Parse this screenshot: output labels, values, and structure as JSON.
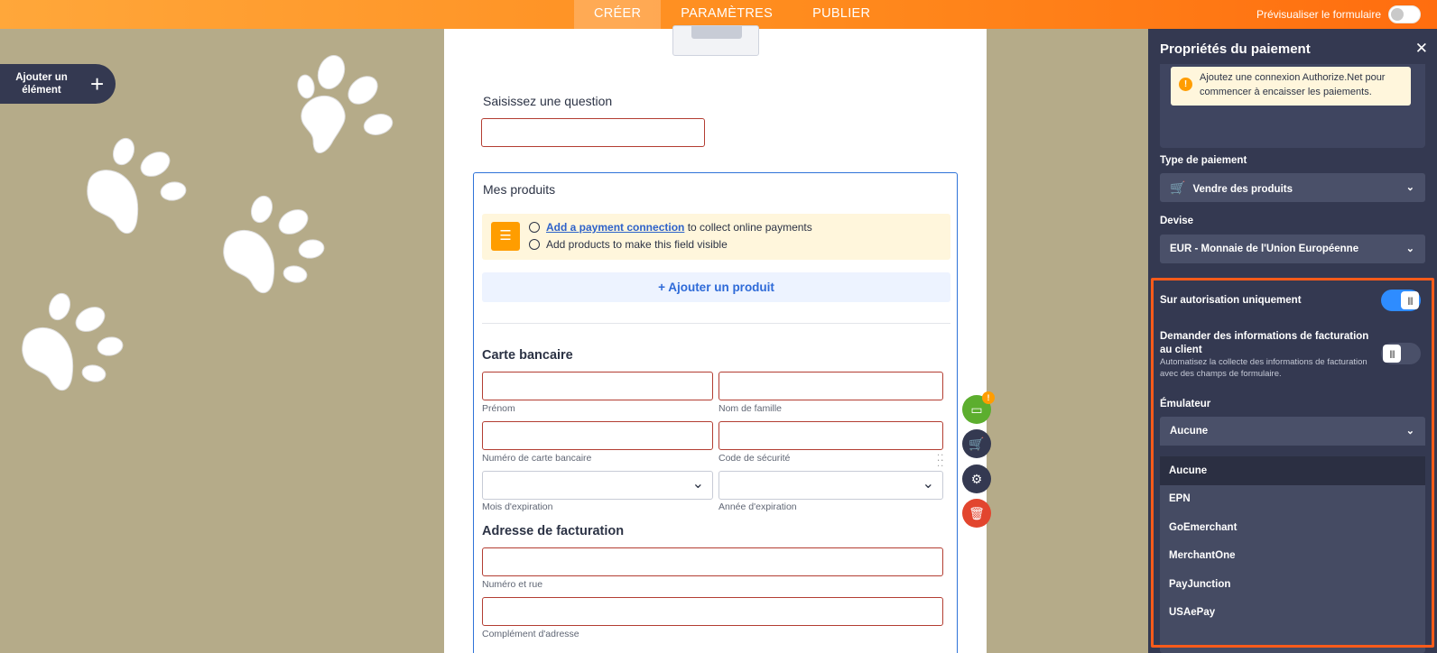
{
  "topbar": {
    "tabs": [
      "CRÉER",
      "PARAMÈTRES",
      "PUBLIER"
    ],
    "preview_label": "Prévisualiser le formulaire"
  },
  "add_element": {
    "label": "Ajouter un élément"
  },
  "form": {
    "question_label": "Saisissez une question",
    "products": {
      "title": "Mes produits",
      "notice_link": "Add a payment connection",
      "notice_line1_rest": " to collect online payments",
      "notice_line2": "Add products to make this field visible",
      "add_product_label": "+ Ajouter un produit"
    },
    "card": {
      "title": "Carte bancaire",
      "first_name": "Prénom",
      "last_name": "Nom de famille",
      "card_number": "Numéro de carte bancaire",
      "security_code": "Code de sécurité",
      "exp_month": "Mois d'expiration",
      "exp_year": "Année d'expiration"
    },
    "billing": {
      "title": "Adresse de facturation",
      "street": "Numéro et rue",
      "address2": "Complément d'adresse"
    }
  },
  "tools": {
    "badge": "!"
  },
  "panel": {
    "title": "Propriétés du paiement",
    "warning": "Ajoutez une connexion Authorize.Net pour commencer à encaisser les paiements.",
    "payment_type_label": "Type de paiement",
    "payment_type_value": "Vendre des produits",
    "currency_label": "Devise",
    "currency_value": "EUR - Monnaie de l'Union Européenne",
    "auth_only_label": "Sur autorisation uniquement",
    "auth_only_on": true,
    "billing_info_label": "Demander des informations de facturation au client",
    "billing_info_desc": "Automatisez la collecte des informations de facturation avec des champs de formulaire.",
    "billing_info_on": false,
    "emulator_label": "Émulateur",
    "emulator_value": "Aucune",
    "emulator_options": [
      "Aucune",
      "EPN",
      "GoEmerchant",
      "MerchantOne",
      "PayJunction",
      "USAePay"
    ]
  }
}
